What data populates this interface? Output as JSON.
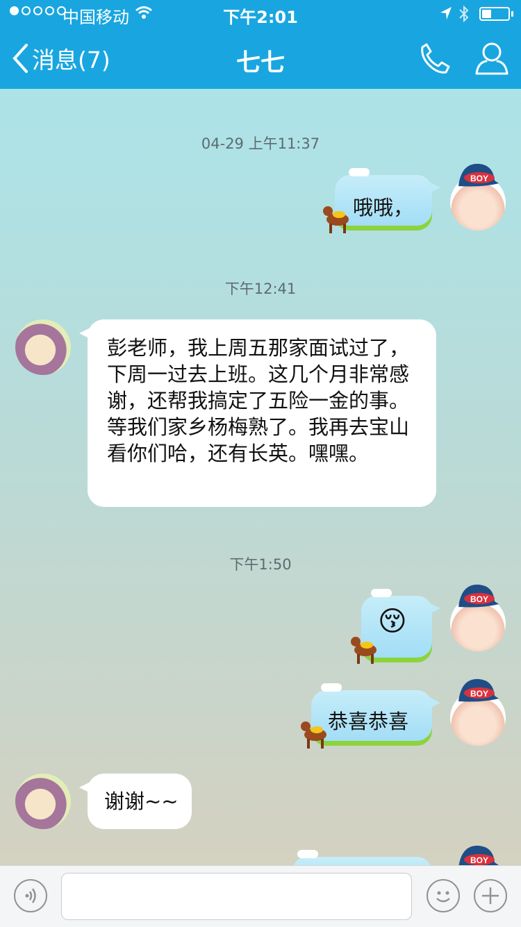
{
  "status_bar": {
    "carrier": "中国移动",
    "time": "下午2:01",
    "battery_level": 0.35
  },
  "nav": {
    "back_label": "消息(7)",
    "title": "七七"
  },
  "messages": [
    {
      "type": "timestamp",
      "text": "04-29 上午11:37"
    },
    {
      "type": "outgoing",
      "text": "哦哦，"
    },
    {
      "type": "timestamp",
      "text": "下午12:41"
    },
    {
      "type": "incoming",
      "text": "彭老师，我上周五那家面试过了，下周一过去上班。这几个月非常感谢，还帮我搞定了五险一金的事。等我们家乡杨梅熟了。我再去宝山看你们哈，还有长英。嘿嘿。"
    },
    {
      "type": "timestamp",
      "text": "下午1:50"
    },
    {
      "type": "outgoing",
      "text": "😚"
    },
    {
      "type": "outgoing",
      "text": "恭喜恭喜"
    },
    {
      "type": "incoming",
      "text": "谢谢~~"
    }
  ],
  "avatars": {
    "me_cap_text": "BOY"
  },
  "input": {
    "placeholder": ""
  },
  "colors": {
    "nav_bar": "#19a6e0",
    "outgoing_bubble": "#b5e6f8",
    "incoming_bubble": "#ffffff"
  },
  "icons": [
    "back-chevron-icon",
    "phone-icon",
    "profile-icon",
    "voice-icon",
    "emoji-icon",
    "plus-icon",
    "wifi-icon",
    "location-icon",
    "bluetooth-icon",
    "battery-icon"
  ]
}
